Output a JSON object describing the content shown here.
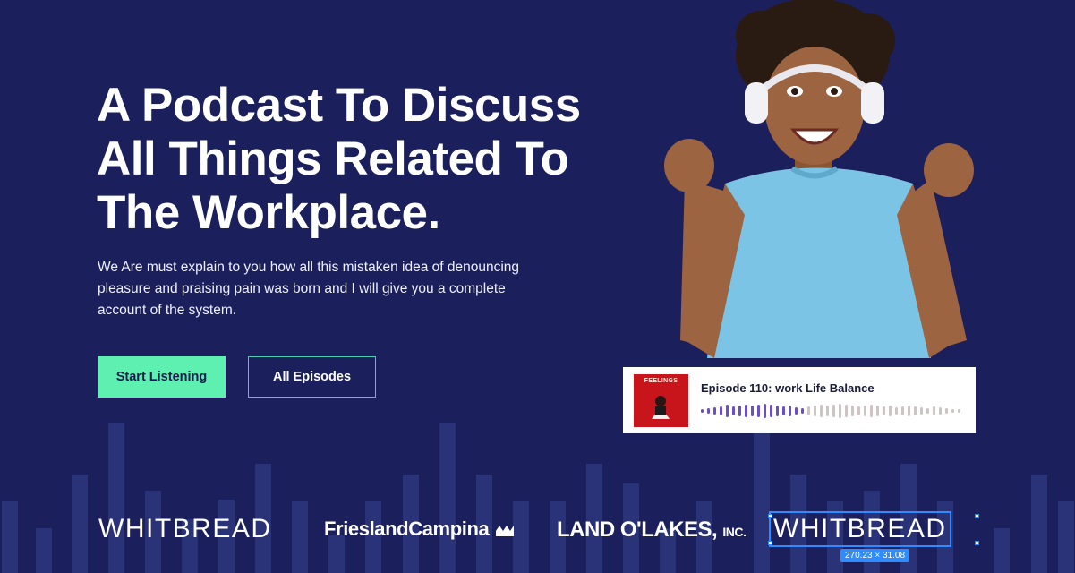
{
  "hero": {
    "headline_lines": [
      "A Podcast To Discuss",
      "All Things Related To",
      "The Workplace."
    ],
    "description": "We Are must explain to you how all this mistaken idea of denouncing pleasure and praising pain was born and I will give you a complete account of the system.",
    "primary_button": "Start Listening",
    "secondary_button": "All Episodes"
  },
  "episode": {
    "thumb_label": "FEELINGS",
    "title": "Episode 110: work Life Balance",
    "progress": 0.4
  },
  "logos": {
    "whitbread_1": "WHITBREAD",
    "friesland": "FrieslandCampina",
    "landolakes": "LAND O'LAKES,",
    "landolakes_suffix": "INC.",
    "whitbread_2": "WHITBREAD",
    "selection_badge": "270.23 × 31.08"
  },
  "colors": {
    "background": "#1b1f5c",
    "accent": "#5ef0b0",
    "wave_played": "#6b4fc9",
    "wave_unplayed": "#cfc4c4",
    "selection": "#2f8cff"
  }
}
